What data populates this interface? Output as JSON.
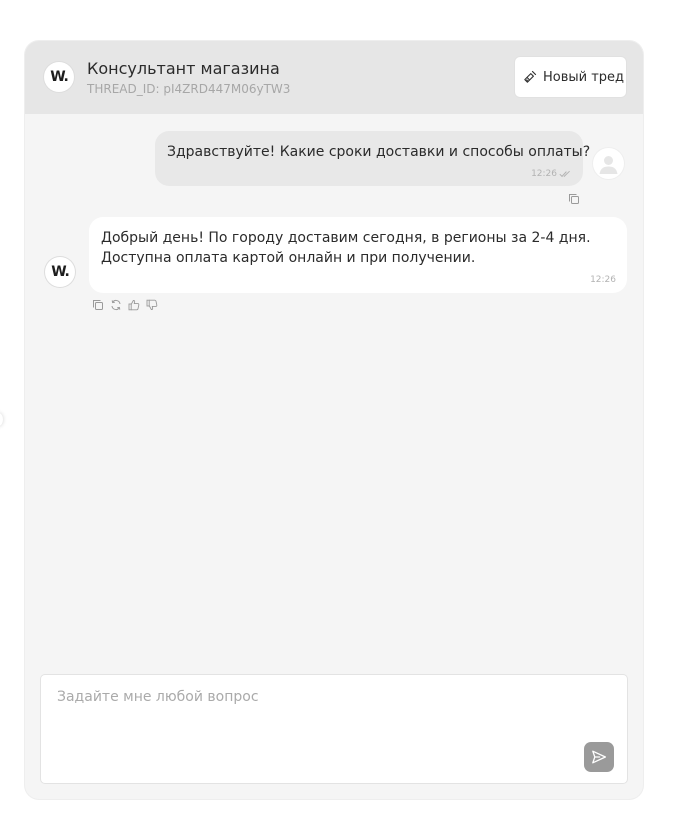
{
  "header": {
    "logo_text": "W.",
    "title": "Консультант магазина",
    "thread_id": "THREAD_ID: pI4ZRD447M06yTW3",
    "new_thread_label": "Новый тред",
    "new_thread_icon": "broom-icon"
  },
  "messages": [
    {
      "role": "user",
      "text": "Здравствуйте! Какие сроки доставки и способы оплаты?",
      "time": "12:26",
      "status": "read-double-check",
      "actions": [
        "copy-icon"
      ]
    },
    {
      "role": "assistant",
      "avatar_text": "W.",
      "text": "Добрый день! По городу доставим сегодня, в регионы за 2-4 дня. Доступна оплата картой онлайн и при получении.",
      "time": "12:26",
      "actions": [
        "copy-icon",
        "regenerate-icon",
        "thumbs-up-icon",
        "thumbs-down-icon"
      ]
    }
  ],
  "composer": {
    "placeholder": "Задайте мне любой вопрос",
    "value": "",
    "send_icon": "send-icon"
  },
  "colors": {
    "header_bg": "#e6e6e6",
    "window_bg": "#f5f5f5",
    "user_bubble_bg": "#e8e8e8",
    "bot_bubble_bg": "#ffffff",
    "send_button_bg": "#9a9a9a",
    "text": "#2b2b2b",
    "muted_text": "#a7a7a7"
  }
}
